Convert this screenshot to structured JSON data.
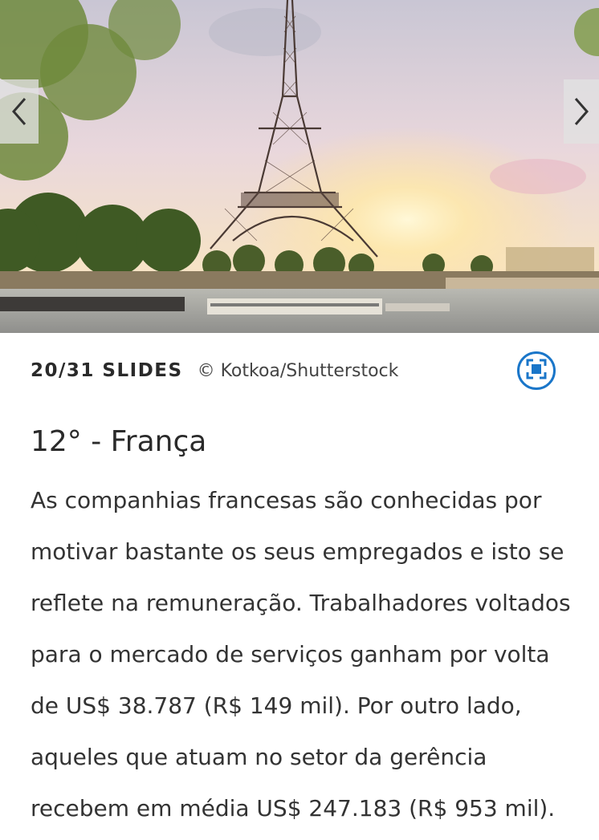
{
  "slideshow": {
    "counter": "20/31 SLIDES",
    "credit": "© Kotkoa/Shutterstock",
    "prev_icon": "chevron-left-icon",
    "next_icon": "chevron-right-icon",
    "expand_icon": "fullscreen-icon",
    "accent_color": "#1a76c9"
  },
  "article": {
    "title": "12° - França",
    "body": "As companhias francesas são conhecidas por motivar bastante os seus empregados e isto se reflete na remuneração. Trabalhadores voltados para o mercado de serviços ganham por volta de US$ 38.787 (R$ 149 mil). Por outro lado, aqueles que atuam no setor da gerência recebem em média US$ 247.183 (R$ 953 mil)."
  }
}
